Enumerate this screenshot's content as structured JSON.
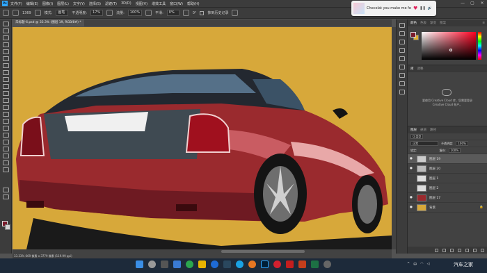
{
  "menubar": {
    "app_logo": "Ps",
    "items": [
      "文件(F)",
      "编辑(E)",
      "图像(I)",
      "图层(L)",
      "文字(Y)",
      "选择(S)",
      "滤镜(T)",
      "3D(D)",
      "视图(V)",
      "增效工具",
      "窗口(W)",
      "帮助(H)"
    ]
  },
  "options": {
    "brush_size": "1369",
    "mode_label": "模式:",
    "mode_value": "画笔",
    "opacity_label": "不透明度:",
    "opacity_value": "17%",
    "flow_label": "流量:",
    "flow_value": "100%",
    "smooth_label": "平滑:",
    "smooth_value": "0%",
    "angle_value": "0°",
    "history_label": "抹到历史记录"
  },
  "document": {
    "tab_title": "未标题-6.psd @ 33.3% (图层 19, RGB/8#) *"
  },
  "status": {
    "text": "33.33%   669 像素 x 3779 像素 (119.99 ppi)"
  },
  "notification": {
    "text": "Chocolat you make me fe"
  },
  "color_panel": {
    "tabs": [
      "颜色",
      "色板",
      "渐变",
      "图案"
    ],
    "foreground": "#7a1a2a",
    "background": "#e0b030"
  },
  "library_panel": {
    "tabs": [
      "库",
      "调整"
    ],
    "message_line1": "要使用 Creative Cloud 库，您需要登录",
    "message_line2": "Creative Cloud 帐户。"
  },
  "layers_panel": {
    "tabs": [
      "图层",
      "通道",
      "路径"
    ],
    "filter_label": "Q 类型",
    "blend_mode": "正常",
    "opacity_label": "不透明度:",
    "opacity_value": "100%",
    "lock_label": "锁定:",
    "fill_label": "填充:",
    "fill_value": "100%",
    "layers": [
      {
        "name": "图层 19",
        "selected": true
      },
      {
        "name": "图层 20",
        "selected": false
      },
      {
        "name": "图层 1",
        "selected": false
      },
      {
        "name": "图层 2",
        "selected": false
      },
      {
        "name": "图层 17",
        "selected": false
      },
      {
        "name": "背景",
        "selected": false
      }
    ]
  },
  "tray": {
    "language": "中",
    "watermark": "汽车之家"
  },
  "canvas": {
    "background_color": "#d7a83a",
    "car_color": "#9a2a2e"
  }
}
